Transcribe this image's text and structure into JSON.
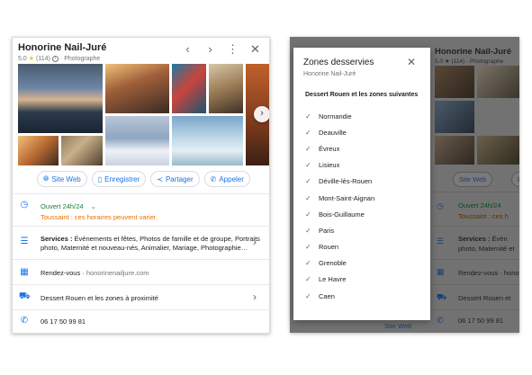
{
  "business": {
    "name": "Honorine Nail-Juré",
    "rating": "5,0",
    "reviews": "(114)",
    "category": "Photographe"
  },
  "actions": [
    {
      "label": "Site Web",
      "icon": "globe-icon"
    },
    {
      "label": "Enregistrer",
      "icon": "bookmark-icon"
    },
    {
      "label": "Partager",
      "icon": "share-icon"
    },
    {
      "label": "Appeler",
      "icon": "phone-icon"
    }
  ],
  "hours": {
    "status": "Ouvert 24h/24",
    "notice": "Toussaint : ces horaires peuvent varier."
  },
  "services": {
    "label": "Services :",
    "line1": " Événements et fêtes, Photos de famille et de groupe, Portraits",
    "line2": "photo, Maternité et nouveau-nés, Animalier, Mariage, Photographie…"
  },
  "appointment": {
    "label": "Rendez-vous",
    "separator": " · ",
    "site": "honorinenailjure.com"
  },
  "service_area": "Dessert Rouen et les zones à proximité",
  "phone": "06 17 50 99 81",
  "modal": {
    "title": "Zones desservies",
    "subtitle": "Honorine Nail-Juré",
    "heading": "Dessert Rouen et les zones suivantes",
    "zones": [
      "Normandie",
      "Deauville",
      "Évreux",
      "Lisieux",
      "Déville-lès-Rouen",
      "Mont-Saint-Aignan",
      "Bois-Guillaume",
      "Paris",
      "Rouen",
      "Grenoble",
      "Le Havre",
      "Caen"
    ]
  },
  "background": {
    "name": "Honorine Nail-Juré",
    "rating_line": "5,0 ★ (114) · Photographe",
    "site_btn": "Site Web",
    "e_btn": "E",
    "hours": "Ouvert 24h/24",
    "notice": "Toussaint : ces h",
    "services_label": "Services :",
    "services_l1": " Évén",
    "services_l2": "photo, Maternité et",
    "rdv": "Rendez-vous · hono",
    "area": "Dessert Rouen et",
    "phone": "06 17 50 99 81",
    "bottom_link": "Site Web"
  },
  "colors": {
    "accent": "#1a73e8",
    "open_green": "#188038",
    "warning_orange": "#e37400",
    "star": "#fbbc04"
  }
}
